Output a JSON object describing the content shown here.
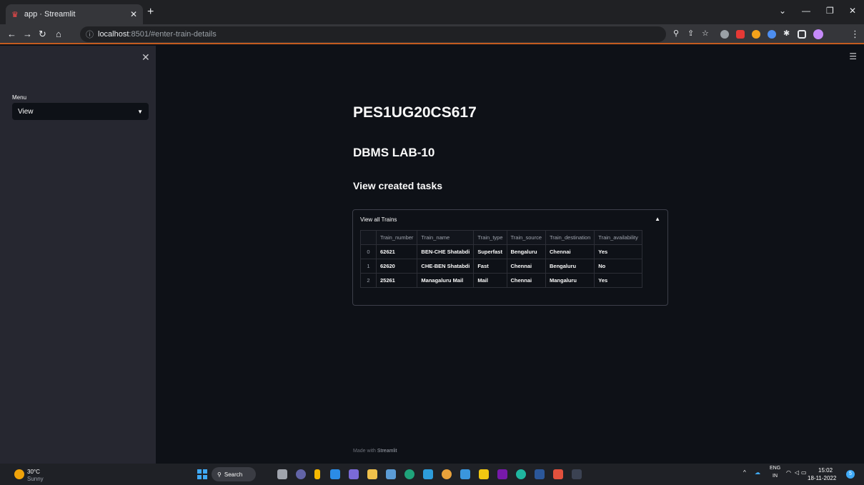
{
  "browser": {
    "tab_title": "app · Streamlit",
    "url_host": "localhost",
    "url_path": ":8501/#enter-train-details"
  },
  "sidebar": {
    "menu_label": "Menu",
    "selected": "View"
  },
  "main": {
    "title": "PES1UG20CS617",
    "subtitle": "DBMS LAB-10",
    "section": "View created tasks",
    "expander_label": "View all Trains",
    "table": {
      "headers": [
        "",
        "Train_number",
        "Train_name",
        "Train_type",
        "Train_source",
        "Train_destination",
        "Train_availability"
      ],
      "rows": [
        [
          "0",
          "62621",
          "BEN-CHE Shatabdi",
          "Superfast",
          "Bengaluru",
          "Chennai",
          "Yes"
        ],
        [
          "1",
          "62620",
          "CHE-BEN Shatabdi",
          "Fast",
          "Chennai",
          "Bengaluru",
          "No"
        ],
        [
          "2",
          "25261",
          "Managaluru Mail",
          "Mail",
          "Chennai",
          "Mangaluru",
          "Yes"
        ]
      ]
    },
    "footer_prefix": "Made with ",
    "footer_brand": "Streamlit"
  },
  "taskbar": {
    "temperature": "30°C",
    "condition": "Sunny",
    "search_label": "Search",
    "lang_top": "ENG",
    "lang_bottom": "IN",
    "time": "15:02",
    "date": "18-11-2022",
    "badge_count": "5"
  },
  "colors": {
    "accent": "#ff4b4b",
    "background": "#0e1117",
    "sidebar": "#262730"
  }
}
